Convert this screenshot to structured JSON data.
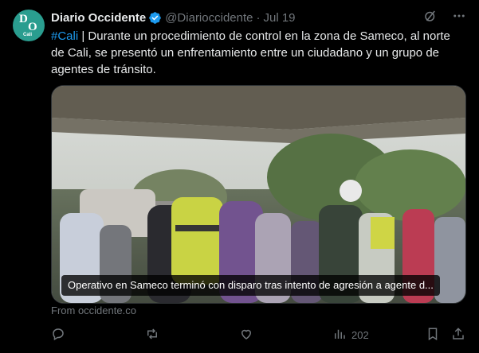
{
  "account": {
    "name": "Diario Occidente",
    "handle": "@Diarioccidente",
    "separator": "·",
    "date": "Jul 19",
    "avatar_letters": {
      "top": "D",
      "bottom": "O",
      "city": "Cali"
    }
  },
  "tweet": {
    "hashtag": "#Cali",
    "body": " | Durante un procedimiento de control en la zona de Sameco, al norte de Cali, se presentó un enfrentamiento entre un ciudadano y un grupo de agentes de tránsito."
  },
  "media": {
    "caption": "Operativo en Sameco terminó con disparo tras intento de agresión a agente d..."
  },
  "link_source": "From occidente.co",
  "actions": {
    "views": "202"
  },
  "colors": {
    "accent": "#1d9bf0",
    "muted": "#71767b",
    "text": "#e7e9ea",
    "background": "#000000"
  },
  "icons": {
    "verified": "verified-badge-icon",
    "grok": "grok-icon",
    "more": "more-icon",
    "reply": "reply-icon",
    "retweet": "retweet-icon",
    "like": "heart-icon",
    "views": "views-chart-icon",
    "bookmark": "bookmark-icon",
    "share": "share-icon"
  }
}
